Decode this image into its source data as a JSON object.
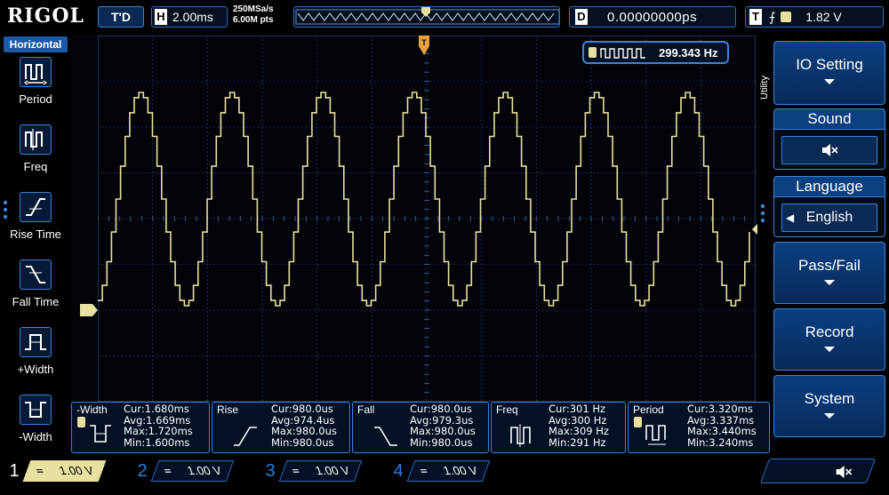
{
  "brand": "RIGOL",
  "top": {
    "trigger_state": "T'D",
    "horizontal_tag": "H",
    "horizontal_scale": "2.00ms",
    "sample_rate": "250MSa/s",
    "memory_depth": "6.00M pts",
    "delay_tag": "D",
    "delay_value": "0.00000000ps",
    "trigger_tag": "T",
    "trigger_level": "1.82 V"
  },
  "left": {
    "title": "Horizontal",
    "items": [
      {
        "label": "Period",
        "icon": "period-icon"
      },
      {
        "label": "Freq",
        "icon": "frequency-icon"
      },
      {
        "label": "Rise Time",
        "icon": "rise-time-icon"
      },
      {
        "label": "Fall Time",
        "icon": "fall-time-icon"
      },
      {
        "label": "+Width",
        "icon": "positive-width-icon"
      },
      {
        "label": "-Width",
        "icon": "negative-width-icon"
      }
    ]
  },
  "counter": {
    "value": "299.343 Hz"
  },
  "right": {
    "section": "Utility",
    "io_setting": "IO Setting",
    "sound": "Sound",
    "language": "Language",
    "language_value": "English",
    "pass_fail": "Pass/Fail",
    "record": "Record",
    "system": "System"
  },
  "measurements": [
    {
      "name": "-Width",
      "cur": "Cur:1.680ms",
      "avg": "Avg:1.669ms",
      "max": "Max:1.720ms",
      "min": "Min:1.600ms"
    },
    {
      "name": "Rise",
      "cur": "Cur:980.0us",
      "avg": "Avg:974.4us",
      "max": "Max:980.0us",
      "min": "Min:980.0us"
    },
    {
      "name": "Fall",
      "cur": "Cur:980.0us",
      "avg": "Avg:979.3us",
      "max": "Max:980.0us",
      "min": "Min:980.0us"
    },
    {
      "name": "Freq",
      "cur": "Cur:301 Hz",
      "avg": "Avg:300 Hz",
      "max": "Max:309 Hz",
      "min": "Min:291 Hz"
    },
    {
      "name": "Period",
      "cur": "Cur:3.320ms",
      "avg": "Avg:3.337ms",
      "max": "Max:3.440ms",
      "min": "Min:3.240ms"
    }
  ],
  "channels": [
    {
      "num": "1",
      "coupling": "=",
      "scale": "1.00 V"
    },
    {
      "num": "2",
      "coupling": "=",
      "scale": "1.00 V"
    },
    {
      "num": "3",
      "coupling": "=",
      "scale": "1.00 V"
    },
    {
      "num": "4",
      "coupling": "=",
      "scale": "1.00 V"
    }
  ],
  "colors": {
    "trace": "#e8e0a0",
    "grid": "#2a4a78",
    "accent": "#3a84d8",
    "channel_inactive": "#2a7fe0"
  },
  "waveform": {
    "cycles_visible": 7,
    "steps_per_cycle": 20
  }
}
